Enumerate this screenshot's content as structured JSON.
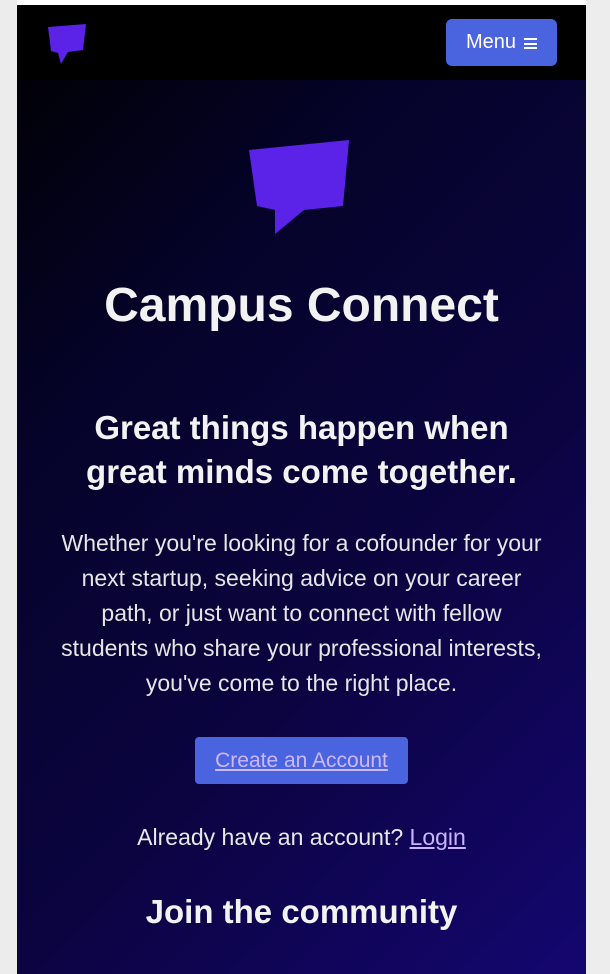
{
  "colors": {
    "brand_purple": "#5b22e8",
    "button_blue": "#4a64e0",
    "link_lavender": "#c9b5ff",
    "navbar_bg": "#000000"
  },
  "navbar": {
    "logo_icon": "speech-bubble-icon",
    "menu_label": "Menu",
    "menu_icon": "hamburger-icon"
  },
  "hero": {
    "logo_icon": "speech-bubble-icon",
    "title": "Campus Connect",
    "tagline": "Great things happen when great minds come together.",
    "description": "Whether you're looking for a cofounder for your next startup, seeking advice on your career path, or just want to connect with fellow students who share your professional interests, you've come to the right place.",
    "cta_label": "Create an Account",
    "login_prompt": "Already have an account?",
    "login_label": "Login"
  },
  "community": {
    "heading": "Join the community"
  }
}
